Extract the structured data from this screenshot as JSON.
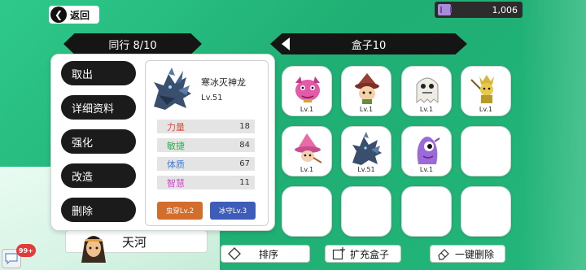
{
  "topbar": {
    "back_label": "返回",
    "currency_value": "1,006",
    "currency_icon": "ticket-icon"
  },
  "team": {
    "header": "同行 8/10",
    "hero_name": "天河"
  },
  "box": {
    "header": "盒子10"
  },
  "menu": {
    "items": [
      "取出",
      "详细资料",
      "强化",
      "改造",
      "删除"
    ]
  },
  "detail": {
    "name": "寒冰灭神龙",
    "level": "Lv.51",
    "stats": [
      {
        "label": "力量",
        "value": "18",
        "color": "#e24c3a"
      },
      {
        "label": "敏捷",
        "value": "84",
        "color": "#2fae4f"
      },
      {
        "label": "体质",
        "value": "67",
        "color": "#3d7bd8"
      },
      {
        "label": "智慧",
        "value": "11",
        "color": "#d548d0"
      }
    ],
    "skills": [
      {
        "label": "虫穿Lv.2",
        "color": "#d36d2c"
      },
      {
        "label": "冰守Lv.3",
        "color": "#3e5db8"
      }
    ]
  },
  "slots": [
    {
      "level": "Lv.1",
      "pet": "pink-demon"
    },
    {
      "level": "Lv.1",
      "pet": "witch-mushroom"
    },
    {
      "level": "Lv.1",
      "pet": "white-ghost"
    },
    {
      "level": "Lv.1",
      "pet": "gold-warrior"
    },
    {
      "level": "Lv.1",
      "pet": "pink-hat-wizard"
    },
    {
      "level": "Lv.51",
      "pet": "ice-dragon"
    },
    {
      "level": "Lv.1",
      "pet": "purple-blob"
    },
    {
      "level": "",
      "pet": ""
    },
    {
      "level": "",
      "pet": ""
    },
    {
      "level": "",
      "pet": ""
    },
    {
      "level": "",
      "pet": ""
    },
    {
      "level": "",
      "pet": ""
    }
  ],
  "bottom": {
    "sort_label": "排序",
    "expand_label": "扩充盒子",
    "delete_all_label": "一键删除"
  },
  "notification": {
    "badge": "99+"
  }
}
